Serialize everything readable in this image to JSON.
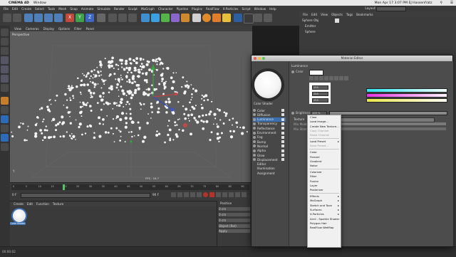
{
  "mac_menu": {
    "apple": "",
    "app": "CINEMA 4D",
    "window": "Window",
    "status_right": "Mon Apr 17  3:07 PM   EJ Hassenfratz"
  },
  "c4d_menu": [
    "File",
    "Edit",
    "Create",
    "Select",
    "Tools",
    "Mesh",
    "Snap",
    "Animate",
    "Simulate",
    "Render",
    "Sculpt",
    "MoGraph",
    "Character",
    "Pipeline",
    "Plugins",
    "RealFlow",
    "X-Particles",
    "Script",
    "Window",
    "Help"
  ],
  "layout_label": "Layout:",
  "right_menu": [
    "File",
    "Edit",
    "View",
    "Objects",
    "Tags",
    "Bookmarks"
  ],
  "objects": [
    {
      "name": "Sphere Obj"
    },
    {
      "name": "Emitter"
    },
    {
      "name": "Sphere"
    }
  ],
  "toolbar_xyz": [
    "X",
    "Y",
    "Z"
  ],
  "viewport_menu": [
    "View",
    "Cameras",
    "Display",
    "Options",
    "Filter",
    "Panel"
  ],
  "viewport": {
    "label": "Perspective",
    "fps": "FPS : 16.7",
    "axis": "Y"
  },
  "timeline": {
    "frame_start": "0 F",
    "frame_end": "90 F",
    "ticks": [
      "0",
      "5",
      "10",
      "15",
      "20",
      "25",
      "30",
      "35",
      "40",
      "45",
      "50",
      "55",
      "60",
      "65",
      "70",
      "75",
      "80",
      "85",
      "90"
    ],
    "current": "0 F"
  },
  "material_manager": {
    "menu": [
      "Create",
      "Edit",
      "Function",
      "Texture"
    ],
    "material_name": "Color Shader"
  },
  "coord_panel": {
    "header": "Position",
    "rows": [
      "0 cm",
      "0 cm",
      "0 cm"
    ],
    "button": "Object (Rel)",
    "apply": "Apply"
  },
  "status_time": "00:00:02",
  "material_editor": {
    "title": "Material Editor",
    "material_name": "Color Shader",
    "channels": [
      "Color",
      "Diffusion",
      "Luminance",
      "Transparency",
      "Reflectance",
      "Environment",
      "Fog",
      "Bump",
      "Normal",
      "Alpha",
      "Glow",
      "Displacement",
      "Editor",
      "Illumination",
      "Assignment"
    ],
    "section": "Luminance",
    "color_label": "Color",
    "color_values": {
      "r": "255",
      "g": "255",
      "b": "255"
    },
    "brightness_label": "Brightness",
    "brightness_value": "100 %",
    "texture_label": "Texture",
    "mix_mode_label": "Mix Mode",
    "mix_strength_label": "Mix Strength",
    "colors": {
      "cyan": "#2ee6f0",
      "magenta": "#e633e6",
      "yellow": "#e8e84a",
      "luminance_chip": "#ffffff"
    }
  },
  "context_menu": [
    {
      "label": "Clear",
      "type": "item"
    },
    {
      "label": "Load Image...",
      "type": "item"
    },
    {
      "label": "Create New Texture...",
      "type": "item"
    },
    {
      "label": "Copy Channel",
      "type": "disabled"
    },
    {
      "label": "Paste Channel",
      "type": "disabled"
    },
    {
      "type": "sep"
    },
    {
      "label": "Load Preset",
      "type": "sub"
    },
    {
      "label": "Save Preset...",
      "type": "disabled"
    },
    {
      "type": "sep"
    },
    {
      "label": "Color",
      "type": "item"
    },
    {
      "label": "Fresnel",
      "type": "item"
    },
    {
      "label": "Gradient",
      "type": "item"
    },
    {
      "label": "Noise",
      "type": "item"
    },
    {
      "type": "sep"
    },
    {
      "label": "Colorizer",
      "type": "item"
    },
    {
      "label": "Filter",
      "type": "item"
    },
    {
      "label": "Fusion",
      "type": "item"
    },
    {
      "label": "Layer",
      "type": "item"
    },
    {
      "label": "Posterizer",
      "type": "item"
    },
    {
      "type": "sep"
    },
    {
      "label": "Effects",
      "type": "sub"
    },
    {
      "label": "MoGraph",
      "type": "sub"
    },
    {
      "label": "Sketch and Toon",
      "type": "sub"
    },
    {
      "label": "Surfaces",
      "type": "sub"
    },
    {
      "label": "X-Particles",
      "type": "sub"
    },
    {
      "label": "Arnil - Sparkle Shader",
      "type": "item"
    },
    {
      "label": "Polygon Hair",
      "type": "item"
    },
    {
      "label": "RealFlow WetMap",
      "type": "item"
    }
  ]
}
